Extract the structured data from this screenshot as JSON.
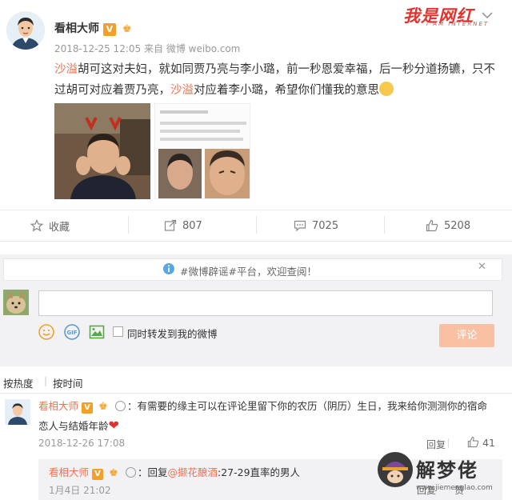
{
  "post": {
    "author": "看相大师",
    "verified_badge": "V",
    "timestamp": "2018-12-25 12:05",
    "source_prefix": "来自",
    "source": "微博 weibo.com",
    "text_parts": [
      {
        "text": "沙溢",
        "tag": true
      },
      {
        "text": "胡可这对夫妇，就如同贾乃亮与李小璐，前一秒恩爱幸福，后一秒分道扬镳，只不过胡可对应着贾乃亮，",
        "tag": false
      },
      {
        "text": "沙溢",
        "tag": true
      },
      {
        "text": "对应着李小璐，希望你们懂我的意思",
        "tag": false
      }
    ],
    "emoji": "thinking-face-emoji"
  },
  "watermark_top": {
    "title": "我是网红",
    "subtitle": "I AM INTERNET"
  },
  "actions": {
    "favorite_label": "收藏",
    "repost_count": "807",
    "comment_count": "7025",
    "like_count": "5208"
  },
  "comment_box": {
    "notice": "#微博辟谣#平台，欢迎查阅！",
    "input_value": "",
    "repost_label": "同时转发到我的微博",
    "submit_label": "评论"
  },
  "sort": {
    "hot": "按热度",
    "separator": "|",
    "time": "按时间"
  },
  "comments": [
    {
      "username": "看相大师",
      "badge": "V",
      "text": "：有需要的缘主可以在评论里留下你的农历（阴历）生日，我来给你测测你的宿命恋人与结婚年龄",
      "emoji": "❤",
      "time": "2018-12-26 17:08",
      "reply_label": "回复",
      "likes": "41",
      "replies": [
        {
          "username": "看相大师",
          "badge": "V",
          "reply_prefix": "：回复",
          "mention": "@撷花酿酒",
          "text": ":27-29直率的男人",
          "time": "1月4日 21:02",
          "reply_label": "回复",
          "like_label": "赞"
        }
      ]
    }
  ],
  "watermark_bottom": {
    "title": "解梦佬",
    "url": "www.jiemenglao.com"
  },
  "colors": {
    "tag": "#eb7350",
    "submit_bg": "#f9c0a3",
    "badge": "#f4a028",
    "panel_bg": "#f2f2f5"
  }
}
